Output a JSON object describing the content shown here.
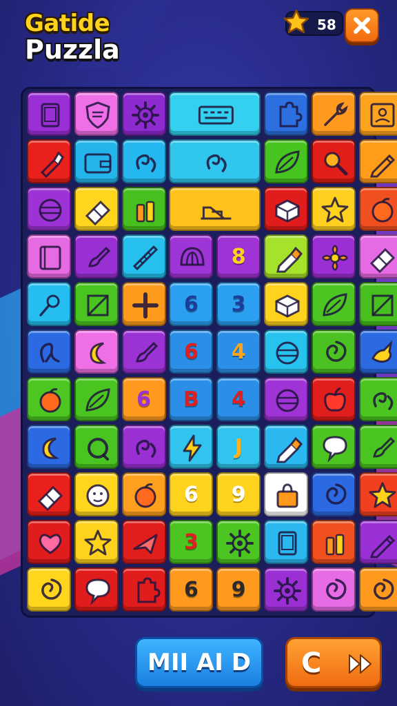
{
  "title": {
    "line1": "Gatide",
    "line2": "Puzzla"
  },
  "score": {
    "value": "58",
    "icon": "star-icon"
  },
  "close_button": {
    "icon": "close-icon"
  },
  "buttons": {
    "left_label": "MII AI D",
    "right_label": "C",
    "right_icon": "fast-forward-icon"
  },
  "board": {
    "rows": [
      [
        {
          "c": "#9a2fd6",
          "i": "tablet"
        },
        {
          "c": "#ef6fe6",
          "i": "shield"
        },
        {
          "c": "#8f2ad0",
          "i": "gear"
        },
        {
          "c": "#33d0f0",
          "i": "keyboard",
          "w": 2
        },
        {
          "c": "#2b6fe0",
          "i": "puzzle"
        },
        {
          "c": "#ff9a1f",
          "i": "wrench"
        },
        {
          "c": "#ffa41f",
          "i": "photo"
        }
      ],
      [
        {
          "c": "#e8211c",
          "i": "lipstick"
        },
        {
          "c": "#24b4ec",
          "i": "wallet"
        },
        {
          "c": "#25b8f0",
          "i": "swirl"
        },
        {
          "c": "#30c6ee",
          "i": "swirl",
          "w": 2
        },
        {
          "c": "#47c41f",
          "i": "leaf"
        },
        {
          "c": "#e21e18",
          "i": "magnifier"
        },
        {
          "c": "#ff9d1a",
          "i": "pencil"
        }
      ],
      [
        {
          "c": "#9d33d4",
          "i": "ball"
        },
        {
          "c": "#ffd51e",
          "i": "eraser"
        },
        {
          "c": "#47c01f",
          "i": "bottles"
        },
        {
          "c": "#ffc21a",
          "i": "ramp",
          "w": 2
        },
        {
          "c": "#e01c1c",
          "i": "box"
        },
        {
          "c": "#ffd01f",
          "i": "star"
        },
        {
          "c": "#f05020",
          "i": "fruit"
        }
      ],
      [
        {
          "c": "#e66ae2",
          "i": "book"
        },
        {
          "c": "#9a30d4",
          "i": "brush"
        },
        {
          "c": "#25c0ee",
          "i": "ruler"
        },
        {
          "c": "#9e35d6",
          "i": "shell"
        },
        {
          "c": "#a033d6",
          "t": "8",
          "tc": "#ffd21c"
        },
        {
          "c": "#a6e12b",
          "i": "marker"
        },
        {
          "c": "#9c2fd4",
          "i": "flower"
        },
        {
          "c": "#e86be6",
          "i": "eraser"
        }
      ],
      [
        {
          "c": "#26bef0",
          "i": "pin"
        },
        {
          "c": "#49c421",
          "i": "square"
        },
        {
          "c": "#ff9b1c",
          "i": "plus"
        },
        {
          "c": "#2ba0f0",
          "t": "6",
          "tc": "#1a3e9a"
        },
        {
          "c": "#2ba0f0",
          "t": "3",
          "tc": "#1a3e9a"
        },
        {
          "c": "#ffd21e",
          "i": "box"
        },
        {
          "c": "#4cc422",
          "i": "leaf"
        },
        {
          "c": "#47c01f",
          "i": "square"
        }
      ],
      [
        {
          "c": "#2b6ae2",
          "i": "pretzel"
        },
        {
          "c": "#ef6fe6",
          "i": "moon"
        },
        {
          "c": "#9b32d3",
          "i": "brush"
        },
        {
          "c": "#2b8fe8",
          "t": "6",
          "tc": "#e02020"
        },
        {
          "c": "#2b8fe8",
          "t": "4",
          "tc": "#ffa41f"
        },
        {
          "c": "#27c2ee",
          "i": "ball"
        },
        {
          "c": "#4cc222",
          "i": "spiral"
        },
        {
          "c": "#2b6ae0",
          "i": "bird"
        }
      ],
      [
        {
          "c": "#4dc622",
          "i": "fruit"
        },
        {
          "c": "#49c421",
          "i": "leaf"
        },
        {
          "c": "#ff9a1f",
          "t": "6",
          "tc": "#9a32d4"
        },
        {
          "c": "#2b8fe8",
          "t": "B",
          "tc": "#e02020"
        },
        {
          "c": "#2b8fe8",
          "t": "4",
          "tc": "#e02020"
        },
        {
          "c": "#a033d6",
          "i": "ball"
        },
        {
          "c": "#e01e1c",
          "i": "apple"
        },
        {
          "c": "#4cc422",
          "i": "swirl"
        }
      ],
      [
        {
          "c": "#2b6ae2",
          "i": "moon"
        },
        {
          "c": "#49c421",
          "i": "ring"
        },
        {
          "c": "#9a30d4",
          "i": "swirl"
        },
        {
          "c": "#30c4ee",
          "i": "bolt"
        },
        {
          "c": "#30c4ee",
          "t": "J",
          "tc": "#ffb21e"
        },
        {
          "c": "#2bb8f0",
          "i": "marker"
        },
        {
          "c": "#4cc422",
          "i": "bubble"
        },
        {
          "c": "#49c421",
          "i": "brush"
        }
      ],
      [
        {
          "c": "#e8211c",
          "i": "eraser"
        },
        {
          "c": "#ffd51e",
          "i": "face"
        },
        {
          "c": "#ffa01e",
          "i": "fruit"
        },
        {
          "c": "#ffd21e",
          "t": "6",
          "tc": "#ffffff"
        },
        {
          "c": "#ffd21e",
          "t": "9",
          "tc": "#ffffff"
        },
        {
          "c": "#ffffff",
          "i": "bag"
        },
        {
          "c": "#2b6ae2",
          "i": "spiral"
        },
        {
          "c": "#f04020",
          "i": "star"
        }
      ],
      [
        {
          "c": "#e01c1c",
          "i": "heart"
        },
        {
          "c": "#ffd21e",
          "i": "star"
        },
        {
          "c": "#e01e1c",
          "i": "plane"
        },
        {
          "c": "#4cc422",
          "t": "3",
          "tc": "#e02020"
        },
        {
          "c": "#4cc422",
          "i": "gear"
        },
        {
          "c": "#2bb8f0",
          "i": "tablet"
        },
        {
          "c": "#f05020",
          "i": "bottles"
        },
        {
          "c": "#9a30d4",
          "i": "pencil"
        }
      ],
      [
        {
          "c": "#ffd51e",
          "i": "spiral"
        },
        {
          "c": "#e01c1c",
          "i": "bubble"
        },
        {
          "c": "#e01c1c",
          "i": "puzzle"
        },
        {
          "c": "#ff9a1f",
          "t": "6",
          "tc": "#2a2a2a"
        },
        {
          "c": "#ff9a1f",
          "t": "9",
          "tc": "#2a2a2a"
        },
        {
          "c": "#9a30d4",
          "i": "gear"
        },
        {
          "c": "#e86be6",
          "i": "spiral"
        },
        {
          "c": "#ff9a1f",
          "i": "spiral"
        }
      ]
    ]
  }
}
